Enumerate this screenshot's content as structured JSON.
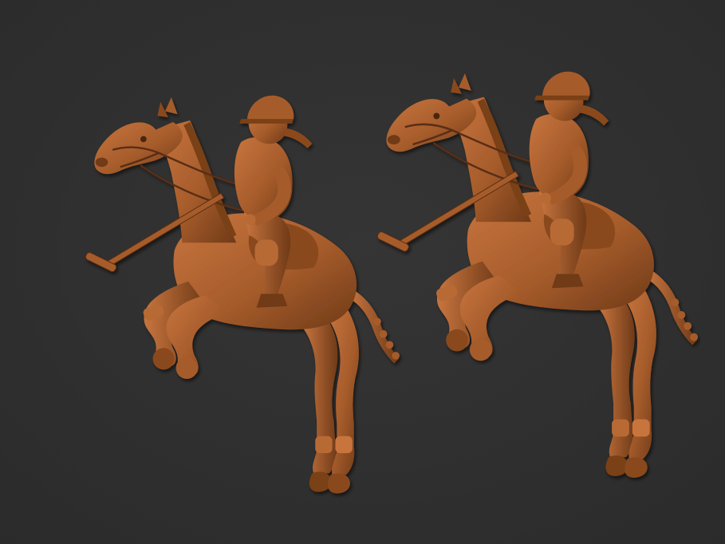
{
  "scene": {
    "subject": "polo-horse-rider-relief",
    "count": 2,
    "colors": {
      "background": "#353535",
      "background_edge": "#2b2b2b",
      "sculpt_light": "#c8753e",
      "sculpt_mid": "#a65c2b",
      "sculpt_dark": "#6f3a18",
      "sculpt_shadow": "#4a250f"
    }
  }
}
